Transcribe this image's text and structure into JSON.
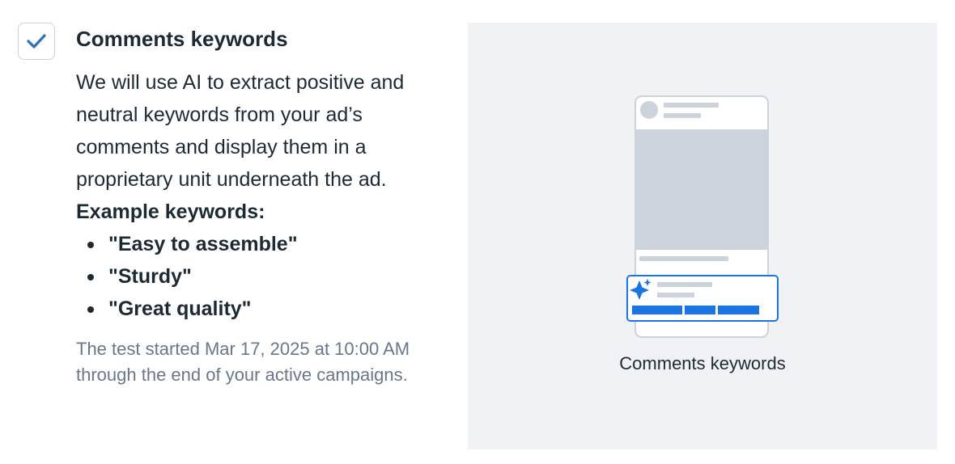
{
  "option": {
    "checked": true,
    "title": "Comments keywords",
    "description": "We will use AI to extract positive and neutral keywords from your ad’s comments and display them in a proprietary unit underneath the ad.",
    "example_heading": "Example keywords:",
    "examples": [
      "\"Easy to assemble\"",
      "\"Sturdy\"",
      "\"Great quality\""
    ],
    "footnote": "The test started Mar 17, 2025 at 10:00 AM through the end of your active campaigns."
  },
  "preview": {
    "caption": "Comments keywords",
    "icon": "sparkle-icon"
  },
  "colors": {
    "accent": "#1b74e4",
    "check": "#2d6fc1",
    "panel_bg": "#f1f2f6",
    "placeholder": "#cdd3db",
    "muted_text": "#67788a"
  }
}
